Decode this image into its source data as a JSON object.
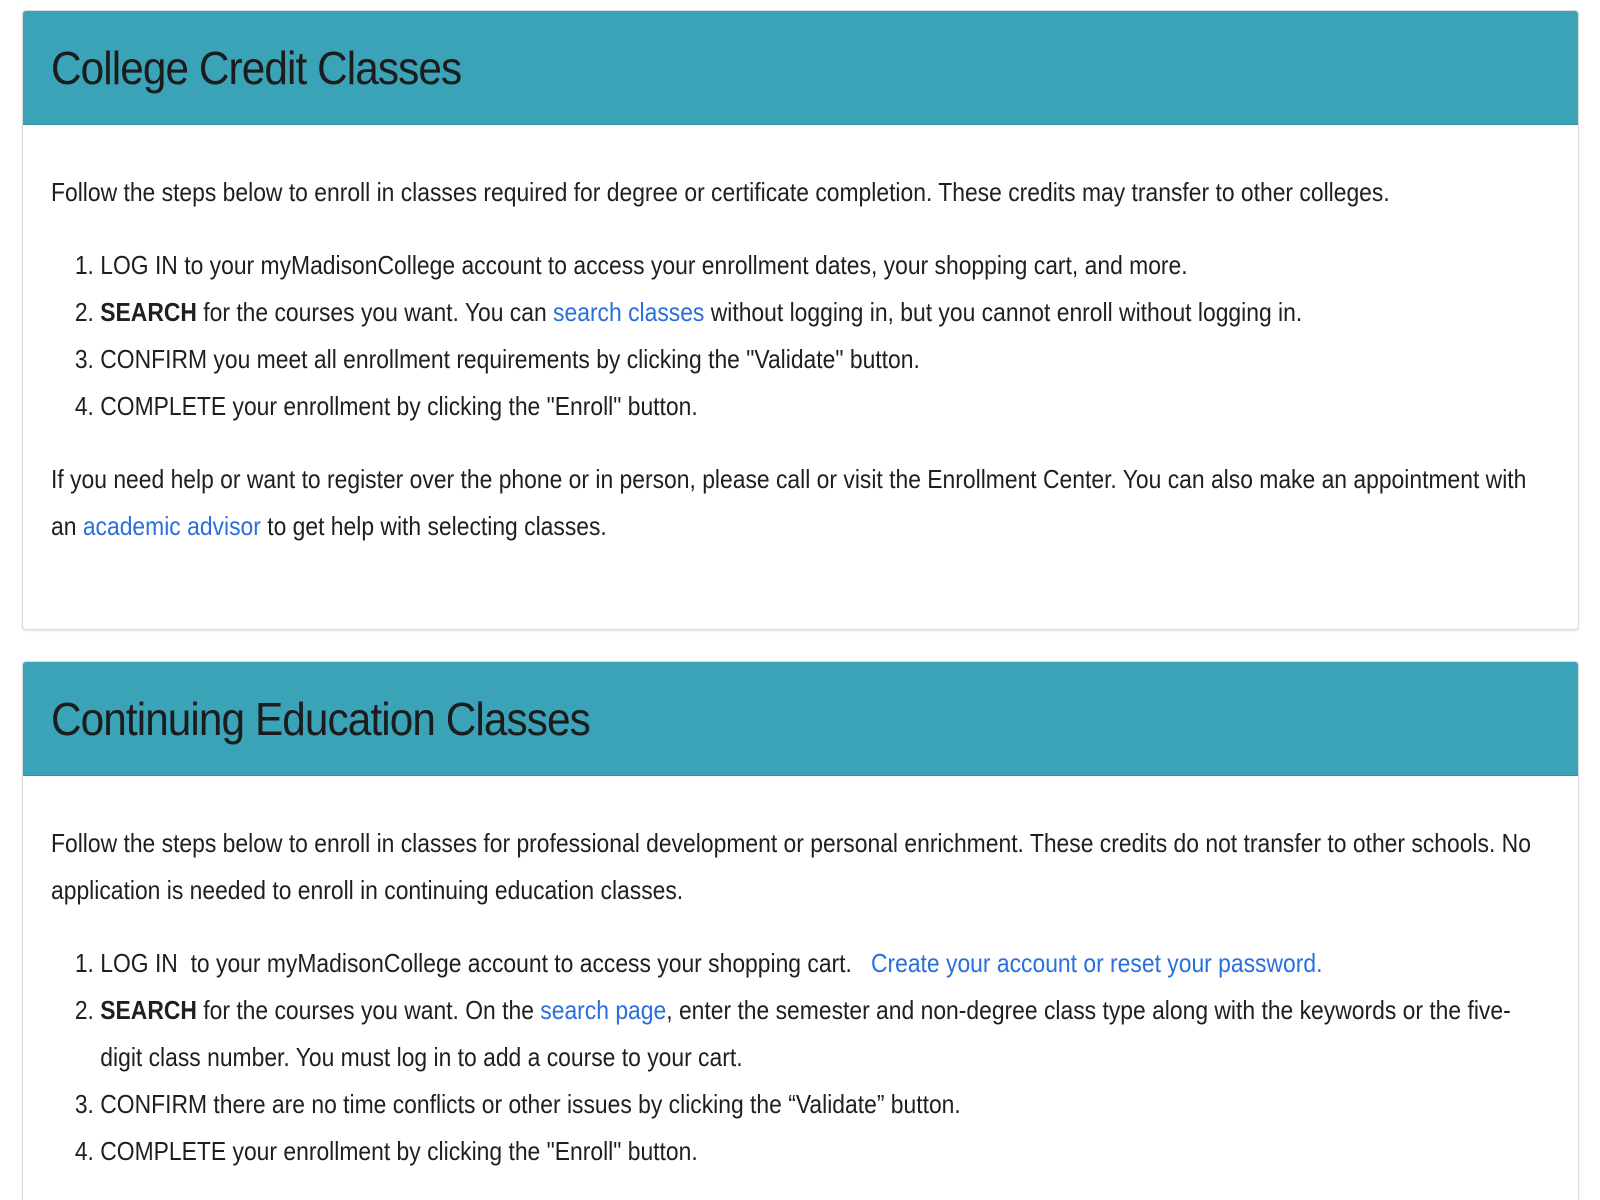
{
  "credit": {
    "title": "College Credit Classes",
    "intro": "Follow the steps below to enroll in classes required for degree or certificate completion. These credits may transfer to other colleges.",
    "steps": [
      {
        "keyword": "LOG IN",
        "text": " to your myMadisonCollege account to access your enrollment dates, your shopping cart, and more."
      },
      {
        "keyword": "SEARCH",
        "text_before": " for the courses you want. You can ",
        "link": "search classes",
        "text_after": " without logging in, but you cannot enroll without logging in."
      },
      {
        "keyword": "CONFIRM",
        "text": " you meet all enrollment requirements by clicking the \"Validate\" button."
      },
      {
        "keyword": "COMPLETE",
        "text": " your enrollment by clicking the \"Enroll\" button."
      }
    ],
    "help_before": "If you need help or want to register over the phone or in person, please call or visit the Enrollment Center. You can also make an appointment with an ",
    "help_link": "academic advisor",
    "help_after": " to get help with selecting classes."
  },
  "continuing": {
    "title": "Continuing Education Classes",
    "intro": "Follow the steps below to enroll in classes for professional development or personal enrichment. These credits do not transfer to other schools.  No application is needed to enroll in continuing education classes.",
    "steps": [
      {
        "keyword": "LOG IN",
        "text": " to your myMadisonCollege account to access your shopping cart.   ",
        "link": "Create your account or reset your password."
      },
      {
        "keyword": "SEARCH",
        "text_before": " for the courses you want. On the ",
        "link": "search page",
        "text_after": ", enter the semester and non-degree class type along with the keywords or the five-digit class number. You must log in to add a course to your cart."
      },
      {
        "keyword": "CONFIRM",
        "text": " there are no time conflicts or other issues by clicking the “Validate” button."
      },
      {
        "keyword": "COMPLETE",
        "text": " your enrollment by clicking the \"Enroll\" button."
      }
    ]
  },
  "colors": {
    "header_bg": "#3aa3b7",
    "link": "#2a6fdb",
    "text": "#1f1f1f"
  }
}
